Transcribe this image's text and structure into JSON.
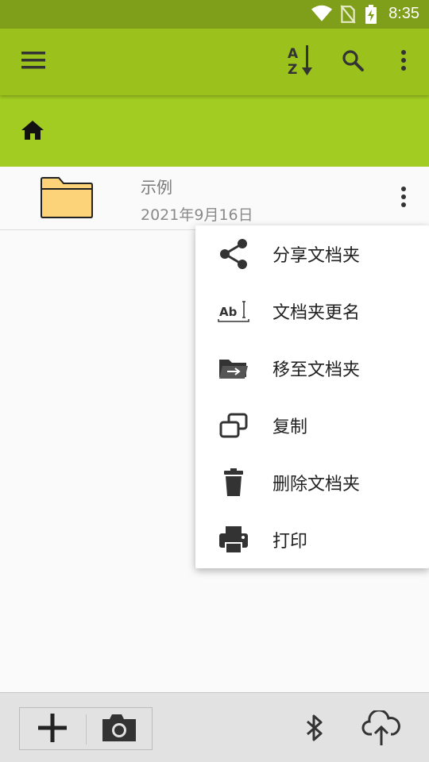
{
  "status_bar": {
    "time": "8:35",
    "icons": [
      "wifi-icon",
      "no-sim-icon",
      "battery-charging-icon"
    ]
  },
  "app_bar": {
    "icons": [
      "menu-icon",
      "sort-az-icon",
      "search-icon",
      "more-vert-icon"
    ]
  },
  "breadcrumb": {
    "icon": "home-icon"
  },
  "file_list": [
    {
      "name": "示例",
      "date": "2021年9月16日",
      "icon": "folder-icon"
    }
  ],
  "context_menu": {
    "items": [
      {
        "label": "分享文档夹",
        "icon": "share-icon"
      },
      {
        "label": "文档夹更名",
        "icon": "rename-icon"
      },
      {
        "label": "移至文档夹",
        "icon": "move-folder-icon"
      },
      {
        "label": "复制",
        "icon": "copy-icon"
      },
      {
        "label": "删除文档夹",
        "icon": "delete-icon"
      },
      {
        "label": "打印",
        "icon": "print-icon"
      }
    ]
  },
  "bottom_bar": {
    "icons": [
      "add-icon",
      "camera-icon",
      "bluetooth-icon",
      "cloud-upload-icon"
    ]
  },
  "colors": {
    "status_bar": "#7f9f1a",
    "app_bar": "#9bc21c",
    "breadcrumb_bar": "#a3cc22",
    "folder_fill": "#fdd37a"
  }
}
